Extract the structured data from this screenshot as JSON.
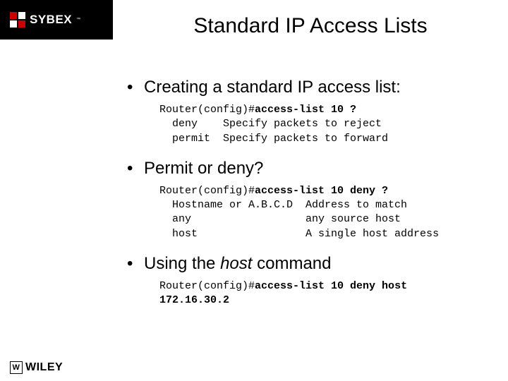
{
  "header": {
    "brand": "SYBEX",
    "tm": "™"
  },
  "title": "Standard IP Access Lists",
  "bullets": {
    "b1": "Creating a standard IP access list:",
    "b2": "Permit or deny?",
    "b3_pre": "Using the ",
    "b3_em": "host",
    "b3_post": " command"
  },
  "code1": {
    "l1a": "Router(config)#",
    "l1b": "access-list 10 ?",
    "l2": "  deny    Specify packets to reject",
    "l3": "  permit  Specify packets to forward"
  },
  "code2": {
    "l1a": "Router(config)#",
    "l1b": "access-list 10 deny ?",
    "l2": "  Hostname or A.B.C.D  Address to match",
    "l3": "  any                  any source host",
    "l4": "  host                 A single host address"
  },
  "code3": {
    "l1a": "Router(config)#",
    "l1b": "access-list 10 deny host",
    "l2": "172.16.30.2"
  },
  "footer": {
    "publisher": "WILEY",
    "mark": "W"
  }
}
